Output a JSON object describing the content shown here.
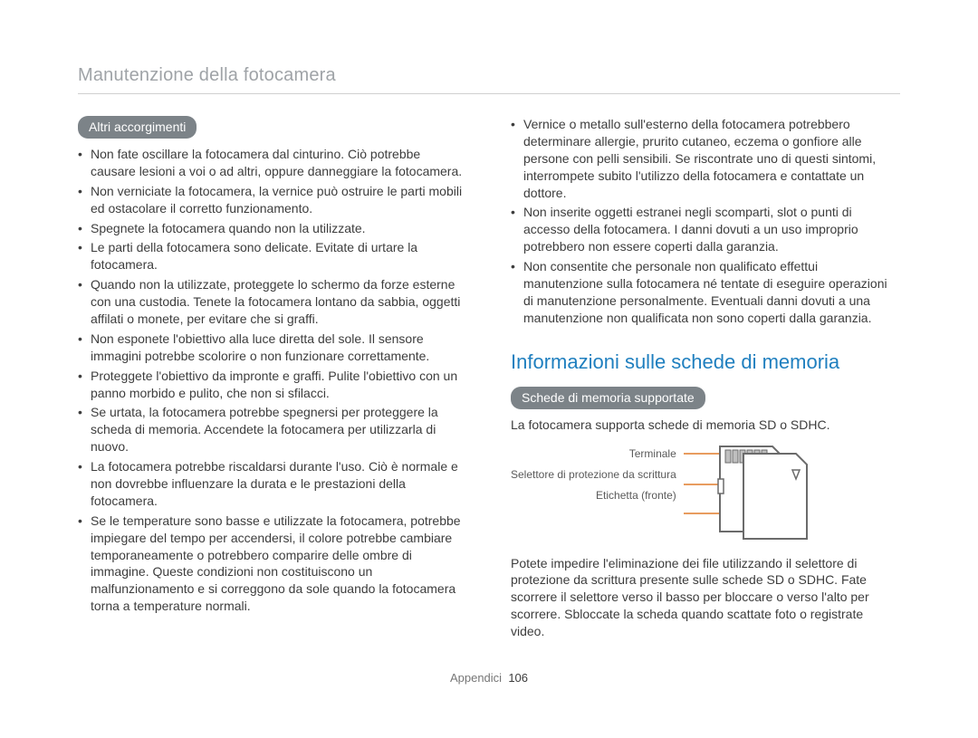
{
  "breadcrumb": "Manutenzione della fotocamera",
  "left": {
    "pill": "Altri accorgimenti",
    "items": [
      "Non fate oscillare la fotocamera dal cinturino. Ciò potrebbe causare lesioni a voi o ad altri, oppure danneggiare la fotocamera.",
      "Non verniciate la fotocamera, la vernice può ostruire le parti mobili ed ostacolare il corretto funzionamento.",
      "Spegnete la fotocamera quando non la utilizzate.",
      "Le parti della fotocamera sono delicate. Evitate di urtare la fotocamera.",
      "Quando non la utilizzate, proteggete lo schermo da forze esterne con una custodia. Tenete la fotocamera lontano da sabbia, oggetti affilati o monete, per evitare che si graffi.",
      "Non esponete l'obiettivo alla luce diretta del sole. Il sensore immagini potrebbe scolorire o non funzionare correttamente.",
      "Proteggete l'obiettivo da impronte e graffi. Pulite l'obiettivo con un panno morbido e pulito, che non si sfilacci.",
      "Se urtata, la fotocamera potrebbe spegnersi per proteggere la scheda di memoria. Accendete la fotocamera per utilizzarla di nuovo.",
      "La fotocamera potrebbe riscaldarsi durante l'uso. Ciò è normale e non dovrebbe influenzare la durata e le prestazioni della fotocamera.",
      "Se le temperature sono basse e utilizzate la fotocamera, potrebbe impiegare del tempo per accendersi, il colore potrebbe cambiare temporaneamente o potrebbero comparire delle ombre di immagine. Queste condizioni non costituiscono un malfunzionamento e si correggono da sole quando la fotocamera torna a temperature normali."
    ]
  },
  "right": {
    "top_items": [
      "Vernice o metallo sull'esterno della fotocamera potrebbero determinare allergie, prurito cutaneo, eczema o gonfiore alle persone con pelli sensibili. Se riscontrate uno di questi sintomi, interrompete subito l'utilizzo della fotocamera e contattate un dottore.",
      "Non inserite oggetti estranei negli scomparti, slot o punti di accesso della fotocamera. I danni dovuti a un uso improprio potrebbero non essere coperti dalla garanzia.",
      "Non consentite che personale non qualificato effettui manutenzione sulla fotocamera né tentate di eseguire operazioni di manutenzione personalmente. Eventuali danni dovuti a una manutenzione non qualificata non sono coperti dalla garanzia."
    ],
    "title": "Informazioni sulle schede di memoria",
    "pill": "Schede di memoria supportate",
    "support_text": "La fotocamera supporta schede di memoria SD o SDHC.",
    "diagram": {
      "terminal": "Terminale",
      "write_protect": "Selettore di protezione da scrittura",
      "label_front": "Etichetta (fronte)"
    },
    "lock_text": "Potete impedire l'eliminazione dei file utilizzando il selettore di protezione da scrittura presente sulle schede SD o SDHC. Fate scorrere il selettore verso il basso per bloccare o verso l'alto per scorrere. Sbloccate la scheda quando scattate foto o registrate video."
  },
  "footer": {
    "section": "Appendici",
    "page": "106"
  }
}
